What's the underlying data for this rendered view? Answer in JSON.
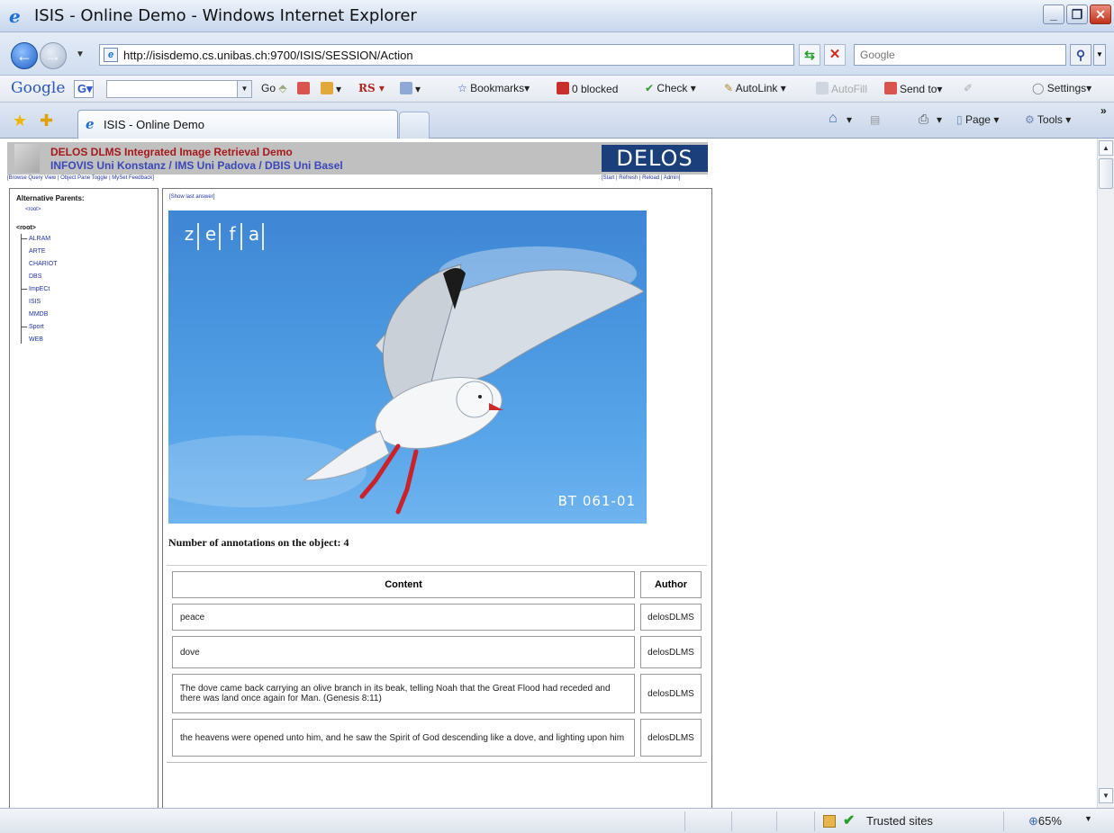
{
  "window": {
    "title": "ISIS - Online Demo - Windows Internet Explorer"
  },
  "address": {
    "url": "http://isisdemo.cs.unibas.ch:9700/ISIS/SESSION/Action",
    "search_placeholder": "Google"
  },
  "google_toolbar": {
    "logo": "Google",
    "go": "Go",
    "rs": "RS",
    "bookmarks": "Bookmarks",
    "blocked": "0 blocked",
    "check": "Check",
    "autolink": "AutoLink",
    "autofill": "AutoFill",
    "send_to": "Send to",
    "settings": "Settings"
  },
  "tabs": [
    {
      "label": "ISIS - Online Demo"
    }
  ],
  "command_bar": {
    "page": "Page",
    "tools": "Tools"
  },
  "page": {
    "header_line1": "DELOS DLMS Integrated Image Retrieval Demo",
    "header_line2": "INFOVIS Uni Konstanz / IMS Uni Padova / DBIS Uni Basel",
    "logo_text": "DELOS",
    "links_left": "[Browse Query View | Object Pane Toggle | MySet Feedback]",
    "links_right": "[Start | Refresh | Reload | Admin]",
    "alt_parents_label": "Alternative Parents:",
    "alt_parent_root": "<root>",
    "tree_root": "<root>",
    "tree_items": [
      "ALRAM",
      "ARTE",
      "CHARIOT",
      "DBS",
      "ImpECt",
      "ISIS",
      "MMDB",
      "Sport",
      "WEB"
    ],
    "show_last_answer": "[Show last answer]",
    "image_brand": [
      "z",
      "e",
      "f",
      "a"
    ],
    "image_code": "BT 061-01",
    "annotation_count": "Number of annotations on the object: 4",
    "table": {
      "headers": [
        "Content",
        "Author"
      ],
      "rows": [
        {
          "content": "peace",
          "author": "delosDLMS"
        },
        {
          "content": "dove",
          "author": "delosDLMS"
        },
        {
          "content": "The dove came back carrying an olive branch in its beak, telling Noah that the Great Flood had receded and there was land once again for Man. (Genesis 8:11)",
          "author": "delosDLMS"
        },
        {
          "content": "the heavens were opened unto him, and he saw the Spirit of God descending like a dove, and lighting upon him",
          "author": "delosDLMS"
        }
      ]
    }
  },
  "status": {
    "zone": "Trusted sites",
    "zoom": "65%"
  }
}
